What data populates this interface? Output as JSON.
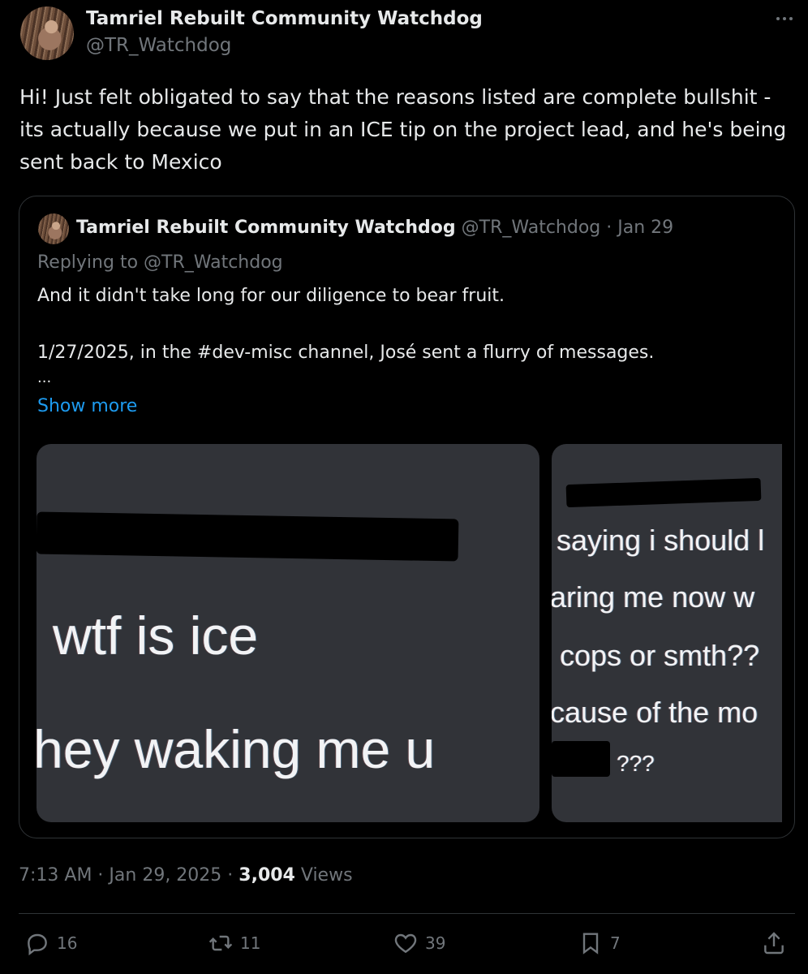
{
  "post": {
    "display_name": "Tamriel Rebuilt Community Watchdog",
    "handle": "@TR_Watchdog",
    "text": "Hi! Just felt obligated to say that the reasons listed are complete bullshit - its actually because we put in an ICE tip on the project lead, and he's being sent back to Mexico",
    "time": "7:13 AM",
    "date": "Jan 29, 2025",
    "views_count": "3,004",
    "views_label": "Views"
  },
  "quoted": {
    "display_name": "Tamriel Rebuilt Community Watchdog",
    "handle": "@TR_Watchdog",
    "date": "Jan 29",
    "replying_label": "Replying to",
    "replying_to": "@TR_Watchdog",
    "line1": "And it didn't take long for our diligence to bear fruit.",
    "line2": "1/27/2025, in the #dev-misc channel, José sent a flurry of messages.",
    "ellipsis": "...",
    "show_more": "Show more",
    "image1_lines": [
      "wtf is ice",
      "hey waking me u"
    ],
    "image2_lines": [
      "saying i should l",
      "aring me now w",
      "cops or smth??",
      "cause of the mo",
      "???"
    ]
  },
  "actions": {
    "replies": "16",
    "reposts": "11",
    "likes": "39",
    "bookmarks": "7"
  },
  "colors": {
    "background": "#000000",
    "text": "#e7e9ea",
    "muted": "#71767b",
    "link": "#1d9bf0",
    "border": "#2f3336",
    "image_bg": "#313338"
  },
  "icons": [
    "more-icon",
    "reply-icon",
    "repost-icon",
    "like-icon",
    "bookmark-icon",
    "share-icon"
  ]
}
